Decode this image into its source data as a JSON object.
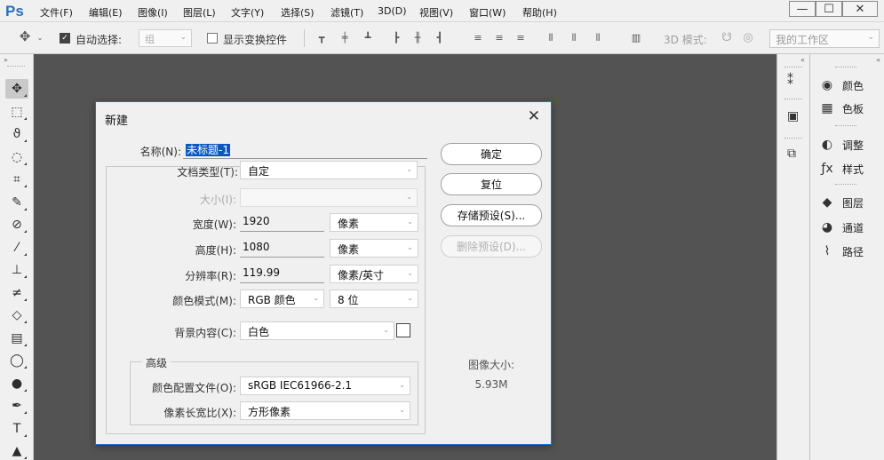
{
  "app": {
    "logo": "Ps",
    "menu": [
      "文件(F)",
      "编辑(E)",
      "图像(I)",
      "图层(L)",
      "文字(Y)",
      "选择(S)",
      "滤镜(T)",
      "3D(D)",
      "视图(V)",
      "窗口(W)",
      "帮助(H)"
    ],
    "window_controls": [
      "—",
      "☐",
      "✕"
    ]
  },
  "options_bar": {
    "auto_select_label": "自动选择:",
    "auto_select_value": "组",
    "show_transform_label": "显示变换控件",
    "mode_3d_label": "3D 模式:",
    "workspace": "我的工作区"
  },
  "tools": [
    {
      "name": "move-tool",
      "glyph": "✥"
    },
    {
      "name": "marquee-tool",
      "glyph": "⬚"
    },
    {
      "name": "lasso-tool",
      "glyph": "ϑ"
    },
    {
      "name": "quick-select-tool",
      "glyph": "◌"
    },
    {
      "name": "crop-tool",
      "glyph": "⌗"
    },
    {
      "name": "eyedropper-tool",
      "glyph": "✎"
    },
    {
      "name": "healing-brush-tool",
      "glyph": "⊘"
    },
    {
      "name": "brush-tool",
      "glyph": "⁄"
    },
    {
      "name": "clone-stamp-tool",
      "glyph": "⊥"
    },
    {
      "name": "history-brush-tool",
      "glyph": "≠"
    },
    {
      "name": "eraser-tool",
      "glyph": "◇"
    },
    {
      "name": "gradient-tool",
      "glyph": "▤"
    },
    {
      "name": "blur-tool",
      "glyph": "◯"
    },
    {
      "name": "dodge-tool",
      "glyph": "●"
    },
    {
      "name": "pen-tool",
      "glyph": "✒"
    },
    {
      "name": "type-tool",
      "glyph": "T"
    },
    {
      "name": "path-select-tool",
      "glyph": "▲"
    }
  ],
  "right_panels": [
    {
      "label": "颜色",
      "icon": "◉"
    },
    {
      "label": "色板",
      "icon": "▦"
    },
    {
      "label": "调整",
      "icon": "◐"
    },
    {
      "label": "样式",
      "icon": "ƒx"
    },
    {
      "label": "图层",
      "icon": "◆"
    },
    {
      "label": "通道",
      "icon": "◕"
    },
    {
      "label": "路径",
      "icon": "⌇"
    }
  ],
  "dialog": {
    "title": "新建",
    "close": "✕",
    "name_label": "名称(N):",
    "name_value": "未标题-1",
    "preset_label": "文档类型(T):",
    "preset_value": "自定",
    "size_label": "大小(I):",
    "width_label": "宽度(W):",
    "width_value": "1920",
    "width_unit": "像素",
    "height_label": "高度(H):",
    "height_value": "1080",
    "height_unit": "像素",
    "resolution_label": "分辨率(R):",
    "resolution_value": "119.99",
    "resolution_unit": "像素/英寸",
    "color_mode_label": "颜色模式(M):",
    "color_mode_value": "RGB 颜色",
    "bit_depth_value": "8 位",
    "background_label": "背景内容(C):",
    "background_value": "白色",
    "advanced_label": "高级",
    "color_profile_label": "颜色配置文件(O):",
    "color_profile_value": "sRGB IEC61966-2.1",
    "pixel_aspect_label": "像素长宽比(X):",
    "pixel_aspect_value": "方形像素",
    "ok_button": "确定",
    "reset_button": "复位",
    "save_preset_button": "存储预设(S)...",
    "delete_preset_button": "删除预设(D)...",
    "image_size_label": "图像大小:",
    "image_size_value": "5.93M"
  }
}
